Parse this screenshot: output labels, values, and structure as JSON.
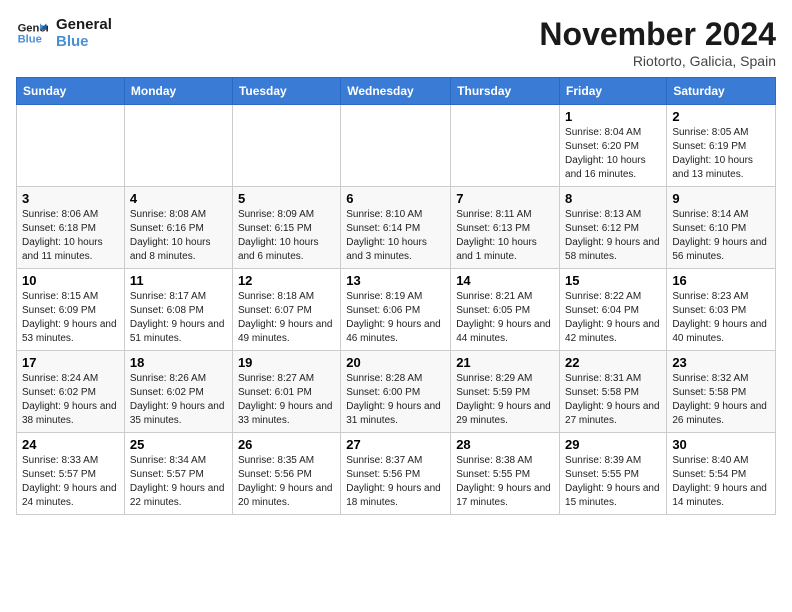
{
  "logo": {
    "line1": "General",
    "line2": "Blue"
  },
  "title": "November 2024",
  "location": "Riotorto, Galicia, Spain",
  "days_of_week": [
    "Sunday",
    "Monday",
    "Tuesday",
    "Wednesday",
    "Thursday",
    "Friday",
    "Saturday"
  ],
  "weeks": [
    [
      {
        "day": "",
        "sunrise": "",
        "sunset": "",
        "daylight": ""
      },
      {
        "day": "",
        "sunrise": "",
        "sunset": "",
        "daylight": ""
      },
      {
        "day": "",
        "sunrise": "",
        "sunset": "",
        "daylight": ""
      },
      {
        "day": "",
        "sunrise": "",
        "sunset": "",
        "daylight": ""
      },
      {
        "day": "",
        "sunrise": "",
        "sunset": "",
        "daylight": ""
      },
      {
        "day": "1",
        "sunrise": "Sunrise: 8:04 AM",
        "sunset": "Sunset: 6:20 PM",
        "daylight": "Daylight: 10 hours and 16 minutes."
      },
      {
        "day": "2",
        "sunrise": "Sunrise: 8:05 AM",
        "sunset": "Sunset: 6:19 PM",
        "daylight": "Daylight: 10 hours and 13 minutes."
      }
    ],
    [
      {
        "day": "3",
        "sunrise": "Sunrise: 8:06 AM",
        "sunset": "Sunset: 6:18 PM",
        "daylight": "Daylight: 10 hours and 11 minutes."
      },
      {
        "day": "4",
        "sunrise": "Sunrise: 8:08 AM",
        "sunset": "Sunset: 6:16 PM",
        "daylight": "Daylight: 10 hours and 8 minutes."
      },
      {
        "day": "5",
        "sunrise": "Sunrise: 8:09 AM",
        "sunset": "Sunset: 6:15 PM",
        "daylight": "Daylight: 10 hours and 6 minutes."
      },
      {
        "day": "6",
        "sunrise": "Sunrise: 8:10 AM",
        "sunset": "Sunset: 6:14 PM",
        "daylight": "Daylight: 10 hours and 3 minutes."
      },
      {
        "day": "7",
        "sunrise": "Sunrise: 8:11 AM",
        "sunset": "Sunset: 6:13 PM",
        "daylight": "Daylight: 10 hours and 1 minute."
      },
      {
        "day": "8",
        "sunrise": "Sunrise: 8:13 AM",
        "sunset": "Sunset: 6:12 PM",
        "daylight": "Daylight: 9 hours and 58 minutes."
      },
      {
        "day": "9",
        "sunrise": "Sunrise: 8:14 AM",
        "sunset": "Sunset: 6:10 PM",
        "daylight": "Daylight: 9 hours and 56 minutes."
      }
    ],
    [
      {
        "day": "10",
        "sunrise": "Sunrise: 8:15 AM",
        "sunset": "Sunset: 6:09 PM",
        "daylight": "Daylight: 9 hours and 53 minutes."
      },
      {
        "day": "11",
        "sunrise": "Sunrise: 8:17 AM",
        "sunset": "Sunset: 6:08 PM",
        "daylight": "Daylight: 9 hours and 51 minutes."
      },
      {
        "day": "12",
        "sunrise": "Sunrise: 8:18 AM",
        "sunset": "Sunset: 6:07 PM",
        "daylight": "Daylight: 9 hours and 49 minutes."
      },
      {
        "day": "13",
        "sunrise": "Sunrise: 8:19 AM",
        "sunset": "Sunset: 6:06 PM",
        "daylight": "Daylight: 9 hours and 46 minutes."
      },
      {
        "day": "14",
        "sunrise": "Sunrise: 8:21 AM",
        "sunset": "Sunset: 6:05 PM",
        "daylight": "Daylight: 9 hours and 44 minutes."
      },
      {
        "day": "15",
        "sunrise": "Sunrise: 8:22 AM",
        "sunset": "Sunset: 6:04 PM",
        "daylight": "Daylight: 9 hours and 42 minutes."
      },
      {
        "day": "16",
        "sunrise": "Sunrise: 8:23 AM",
        "sunset": "Sunset: 6:03 PM",
        "daylight": "Daylight: 9 hours and 40 minutes."
      }
    ],
    [
      {
        "day": "17",
        "sunrise": "Sunrise: 8:24 AM",
        "sunset": "Sunset: 6:02 PM",
        "daylight": "Daylight: 9 hours and 38 minutes."
      },
      {
        "day": "18",
        "sunrise": "Sunrise: 8:26 AM",
        "sunset": "Sunset: 6:02 PM",
        "daylight": "Daylight: 9 hours and 35 minutes."
      },
      {
        "day": "19",
        "sunrise": "Sunrise: 8:27 AM",
        "sunset": "Sunset: 6:01 PM",
        "daylight": "Daylight: 9 hours and 33 minutes."
      },
      {
        "day": "20",
        "sunrise": "Sunrise: 8:28 AM",
        "sunset": "Sunset: 6:00 PM",
        "daylight": "Daylight: 9 hours and 31 minutes."
      },
      {
        "day": "21",
        "sunrise": "Sunrise: 8:29 AM",
        "sunset": "Sunset: 5:59 PM",
        "daylight": "Daylight: 9 hours and 29 minutes."
      },
      {
        "day": "22",
        "sunrise": "Sunrise: 8:31 AM",
        "sunset": "Sunset: 5:58 PM",
        "daylight": "Daylight: 9 hours and 27 minutes."
      },
      {
        "day": "23",
        "sunrise": "Sunrise: 8:32 AM",
        "sunset": "Sunset: 5:58 PM",
        "daylight": "Daylight: 9 hours and 26 minutes."
      }
    ],
    [
      {
        "day": "24",
        "sunrise": "Sunrise: 8:33 AM",
        "sunset": "Sunset: 5:57 PM",
        "daylight": "Daylight: 9 hours and 24 minutes."
      },
      {
        "day": "25",
        "sunrise": "Sunrise: 8:34 AM",
        "sunset": "Sunset: 5:57 PM",
        "daylight": "Daylight: 9 hours and 22 minutes."
      },
      {
        "day": "26",
        "sunrise": "Sunrise: 8:35 AM",
        "sunset": "Sunset: 5:56 PM",
        "daylight": "Daylight: 9 hours and 20 minutes."
      },
      {
        "day": "27",
        "sunrise": "Sunrise: 8:37 AM",
        "sunset": "Sunset: 5:56 PM",
        "daylight": "Daylight: 9 hours and 18 minutes."
      },
      {
        "day": "28",
        "sunrise": "Sunrise: 8:38 AM",
        "sunset": "Sunset: 5:55 PM",
        "daylight": "Daylight: 9 hours and 17 minutes."
      },
      {
        "day": "29",
        "sunrise": "Sunrise: 8:39 AM",
        "sunset": "Sunset: 5:55 PM",
        "daylight": "Daylight: 9 hours and 15 minutes."
      },
      {
        "day": "30",
        "sunrise": "Sunrise: 8:40 AM",
        "sunset": "Sunset: 5:54 PM",
        "daylight": "Daylight: 9 hours and 14 minutes."
      }
    ]
  ]
}
